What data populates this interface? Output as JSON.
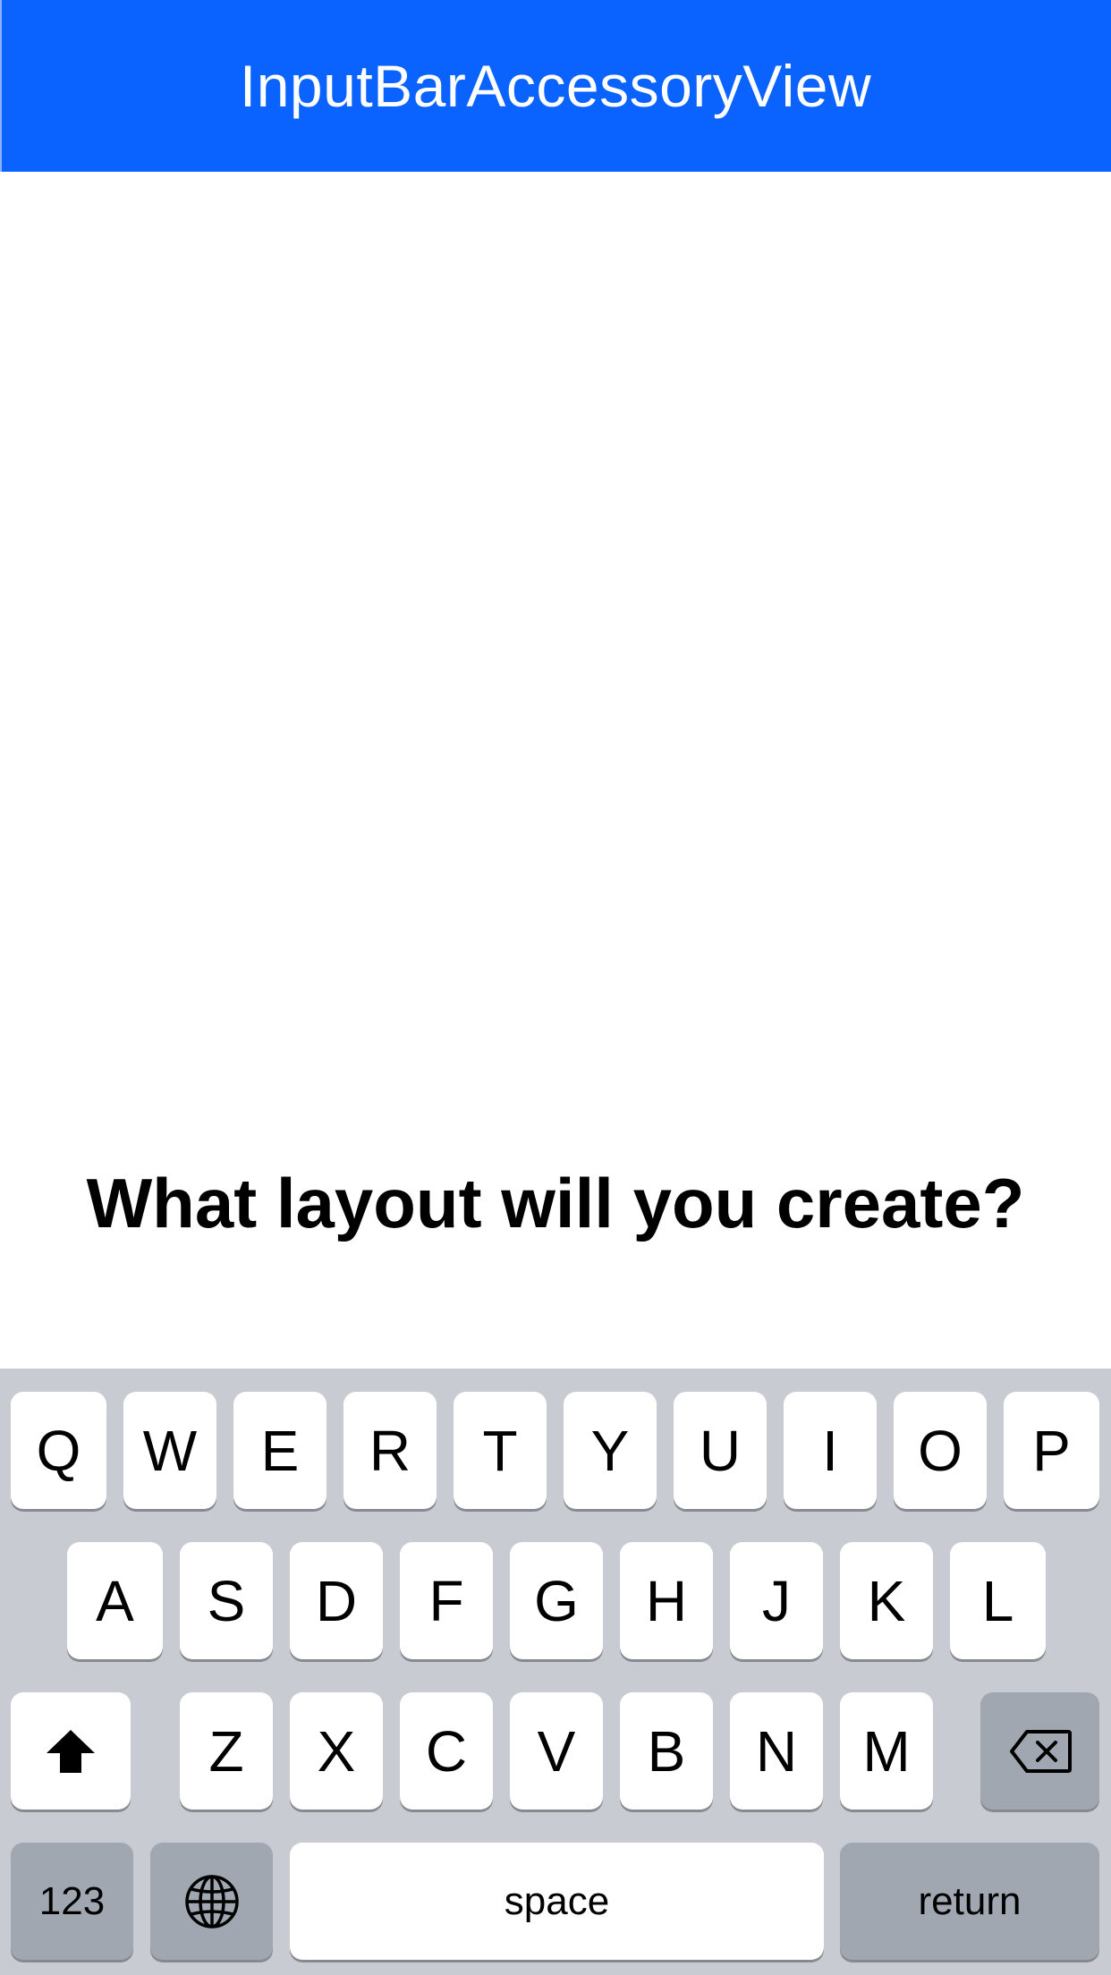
{
  "nav": {
    "title": "InputBarAccessoryView",
    "color": "#0a62ff"
  },
  "main": {
    "headline": "What layout will you create?"
  },
  "keyboard": {
    "row1": [
      "Q",
      "W",
      "E",
      "R",
      "T",
      "Y",
      "U",
      "I",
      "O",
      "P"
    ],
    "row2": [
      "A",
      "S",
      "D",
      "F",
      "G",
      "H",
      "J",
      "K",
      "L"
    ],
    "row3": [
      "Z",
      "X",
      "C",
      "V",
      "B",
      "N",
      "M"
    ],
    "numbers_label": "123",
    "space_label": "space",
    "return_label": "return",
    "icons": {
      "shift": "shift-icon",
      "backspace": "backspace-icon",
      "globe": "globe-icon"
    },
    "background_color": "#c8cbd1"
  }
}
